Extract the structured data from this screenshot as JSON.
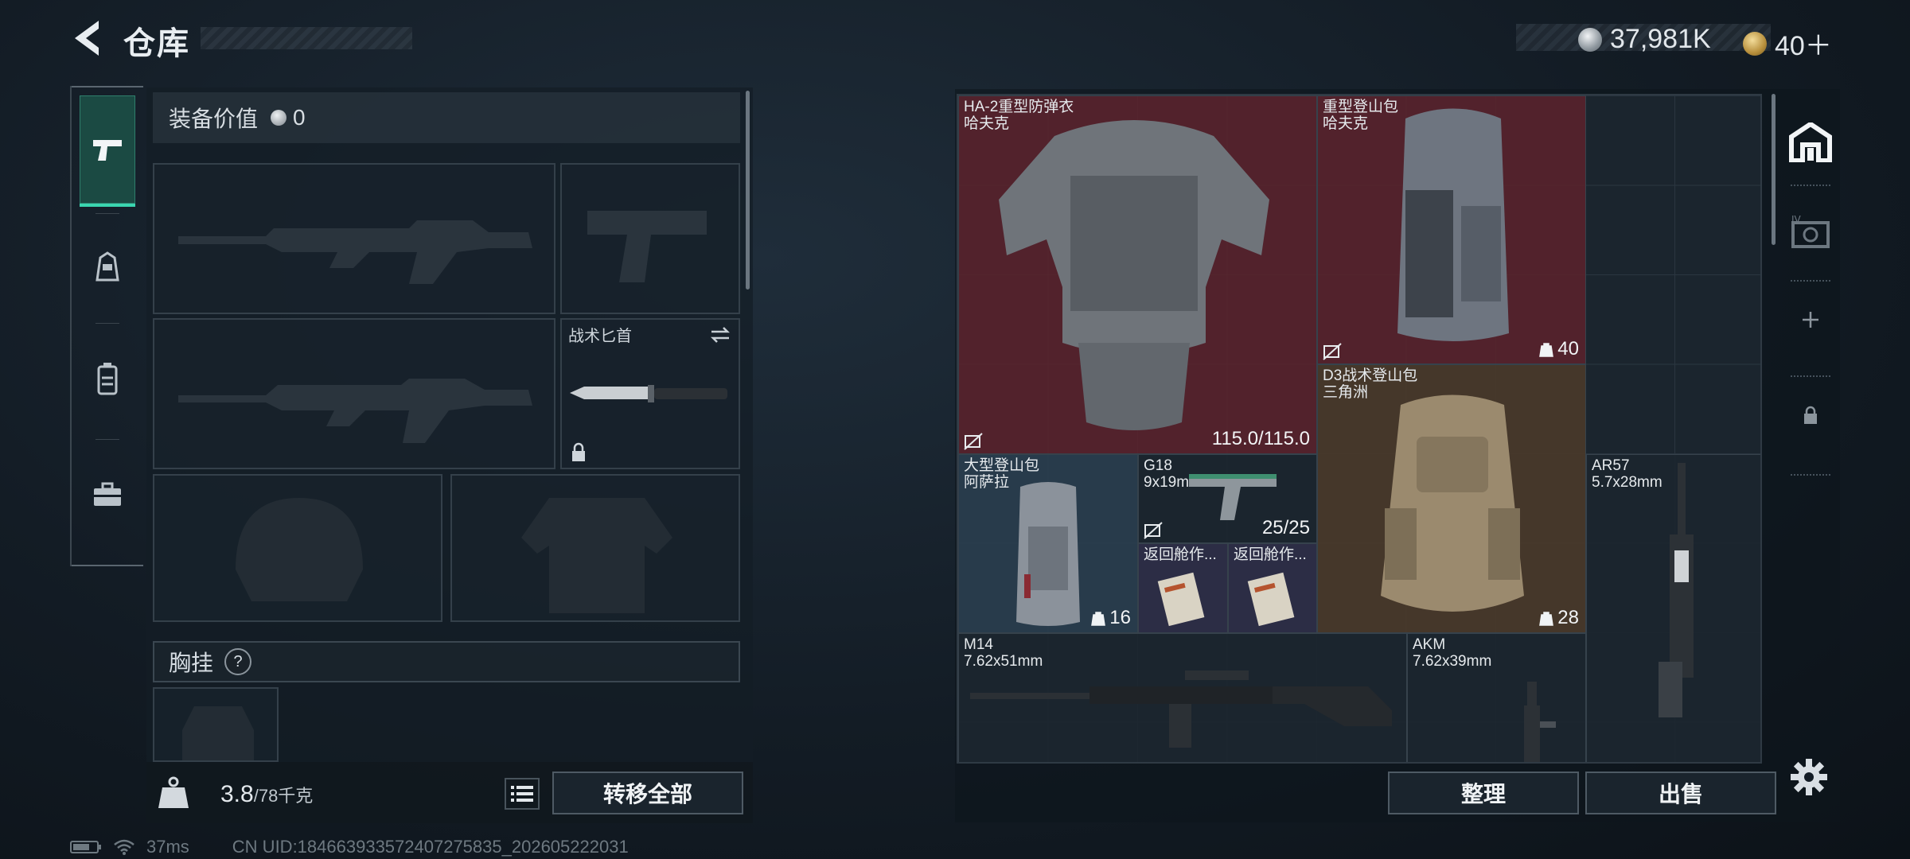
{
  "header": {
    "title": "仓库",
    "silver_amount": "37,981K",
    "gold_amount": "40＋"
  },
  "colors": {
    "accent_green": "#3ad6b0",
    "red_tile": "#5a232b",
    "brown_tile": "#4a3a2a",
    "blue_tile": "#2a3e4f",
    "purple_tile": "#2f2f48"
  },
  "sidebar": {
    "tabs": [
      {
        "icon": "pistol-icon",
        "active": true
      },
      {
        "icon": "helmet-icon",
        "active": false
      },
      {
        "icon": "backpack-icon",
        "active": false
      },
      {
        "icon": "toolbox-icon",
        "active": false
      }
    ]
  },
  "equipment": {
    "value_label": "装备价值",
    "value": "0",
    "slots": {
      "knife_label": "战术匕首"
    },
    "chest_rig_label": "胸挂",
    "help_glyph": "?",
    "weight_current": "3.8",
    "weight_max": "/78千克",
    "transfer_all_label": "转移全部"
  },
  "status": {
    "ping": "37ms",
    "uid": "CN UID:184663933572407275835_202605222031"
  },
  "warehouse": {
    "items": [
      {
        "name": "HA-2重型防弹衣\n哈夫克",
        "bottom_right": "115.0/115.0",
        "tile": "red"
      },
      {
        "name": "重型登山包\n哈夫克",
        "bottom_right": "40",
        "tile": "red"
      },
      {
        "name": "D3战术登山包\n三角洲",
        "bottom_right": "28",
        "tile": "brown"
      },
      {
        "name": "大型登山包\n阿萨拉",
        "bottom_right": "16",
        "tile": "blue"
      },
      {
        "name": "G18\n9x19mm",
        "bottom_right": "25/25",
        "tile": "dark"
      },
      {
        "name": "返回舱作...",
        "bottom_right": "",
        "tile": "purple"
      },
      {
        "name": "返回舱作...",
        "bottom_right": "",
        "tile": "purple"
      },
      {
        "name": "AR57\n5.7x28mm",
        "bottom_right": "",
        "tile": "dark"
      },
      {
        "name": "M14\n7.62x51mm",
        "bottom_right": "",
        "tile": "dark"
      },
      {
        "name": "AKM\n7.62x39mm",
        "bottom_right": "",
        "tile": "dark"
      }
    ],
    "sort_label": "整理",
    "sell_label": "出售"
  },
  "right_sidebar": {
    "items": [
      {
        "icon": "warehouse-icon"
      },
      {
        "icon": "level-iv-case-icon"
      },
      {
        "icon": "plus-icon"
      },
      {
        "icon": "lock-icon"
      }
    ]
  }
}
